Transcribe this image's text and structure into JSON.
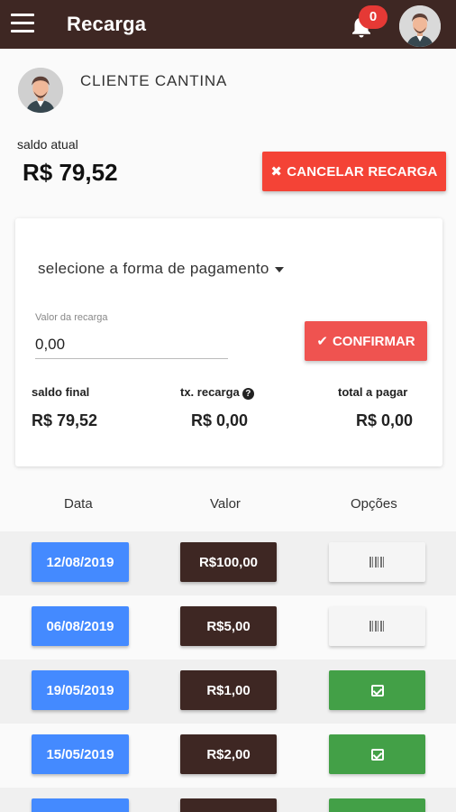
{
  "appbar": {
    "title": "Recarga",
    "notification_count": "0"
  },
  "profile": {
    "name": "CLIENTE CANTINA"
  },
  "balance": {
    "label": "saldo atual",
    "value": "R$ 79,52",
    "cancel_label": "CANCELAR RECARGA"
  },
  "card": {
    "payment_select": "selecione a forma de pagamento",
    "input_label": "Valor da recarga",
    "input_value": "0,00",
    "confirm_label": "CONFIRMAR",
    "summary": {
      "saldo_final_label": "saldo final",
      "saldo_final_value": "R$ 79,52",
      "taxa_label": "tx. recarga",
      "taxa_value": "R$ 0,00",
      "total_label": "total a pagar",
      "total_value": "R$ 0,00"
    }
  },
  "table": {
    "headers": [
      "Data",
      "Valor",
      "Opções"
    ],
    "rows": [
      {
        "date": "12/08/2019",
        "value": "R$100,00",
        "status": "pending",
        "icon": "barcode-icon"
      },
      {
        "date": "06/08/2019",
        "value": "R$5,00",
        "status": "pending",
        "icon": "barcode-icon"
      },
      {
        "date": "19/05/2019",
        "value": "R$1,00",
        "status": "paid",
        "icon": "check-square-icon"
      },
      {
        "date": "15/05/2019",
        "value": "R$2,00",
        "status": "paid",
        "icon": "check-square-icon"
      },
      {
        "date": "",
        "value": "",
        "status": "paid",
        "icon": "check-square-icon"
      }
    ]
  },
  "colors": {
    "appbar": "#3e2723",
    "danger": "#f44336",
    "date_blue": "#448aff",
    "value_brown": "#3e2723",
    "paid_green": "#43a047"
  }
}
